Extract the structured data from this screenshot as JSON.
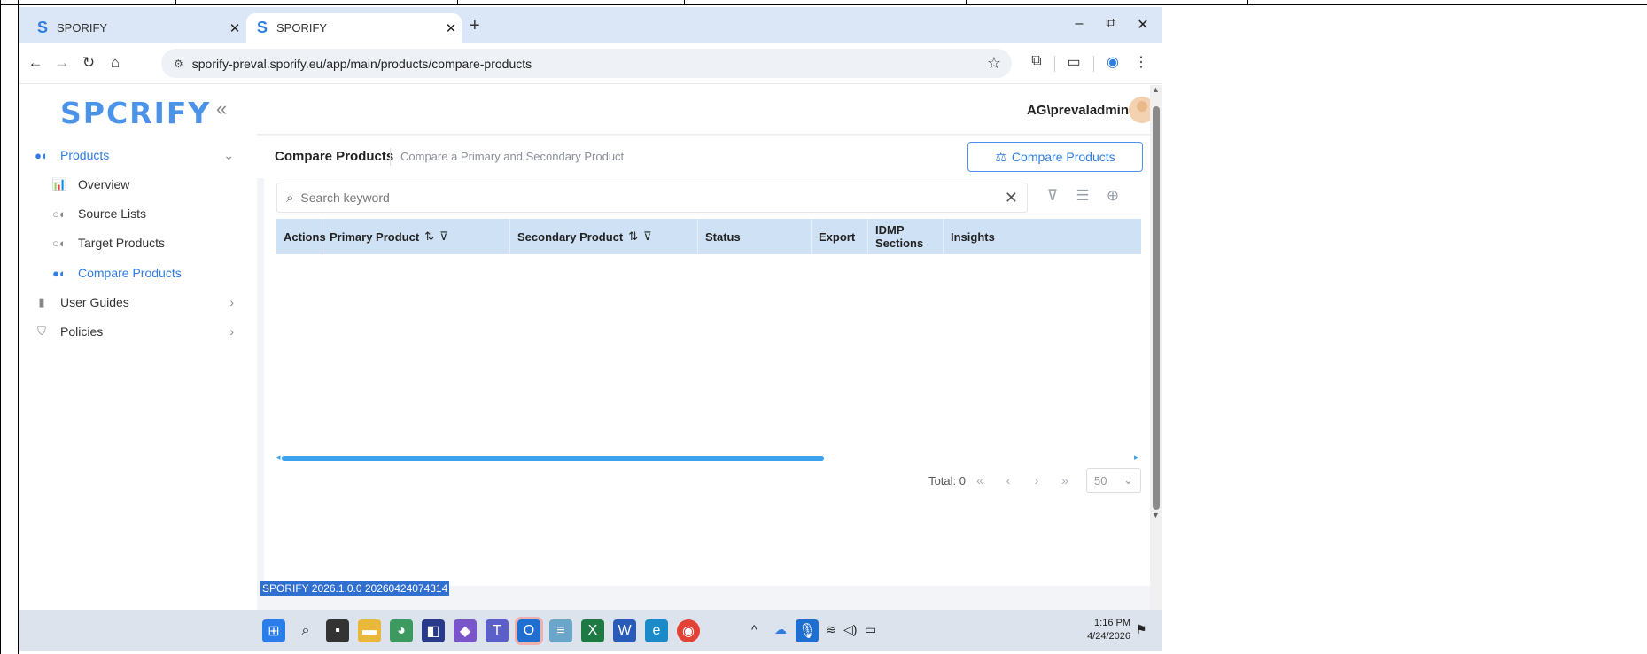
{
  "browser": {
    "tabs": [
      {
        "title": "SPORIFY",
        "logo": "S",
        "active": false
      },
      {
        "title": "SPORIFY",
        "logo": "S",
        "active": true
      }
    ],
    "new_tab": "+",
    "url": "sporify-preval.sporify.eu/app/main/products/compare-products",
    "window_controls": {
      "minimize": "–",
      "restore": "⧉",
      "close": "✕"
    }
  },
  "sidebar": {
    "brand": "SPCRIFY",
    "items": [
      {
        "label": "Products",
        "icon": "pills-icon",
        "level": 0,
        "active": true,
        "chevron": "⌄"
      },
      {
        "label": "Overview",
        "icon": "chart-icon",
        "level": 1
      },
      {
        "label": "Source Lists",
        "icon": "pills-icon",
        "level": 1
      },
      {
        "label": "Target Products",
        "icon": "pills-icon",
        "level": 1
      },
      {
        "label": "Compare Products",
        "icon": "pills-icon",
        "level": 1,
        "active": true
      },
      {
        "label": "User Guides",
        "icon": "book-icon",
        "level": 0,
        "chevron": "›"
      },
      {
        "label": "Policies",
        "icon": "shield-icon",
        "level": 0,
        "chevron": "›"
      }
    ]
  },
  "header": {
    "user": "AG\\prevaladmin"
  },
  "page": {
    "title": "Compare Products",
    "subtitle": "Compare a Primary and Secondary Product",
    "compare_button": "Compare Products"
  },
  "search": {
    "placeholder": "Search keyword"
  },
  "table": {
    "columns": [
      "Actions",
      "Primary Product",
      "Secondary Product",
      "Status",
      "Export",
      "IDMP Sections",
      "Insights"
    ],
    "rows": []
  },
  "pager": {
    "total_label": "Total: 0",
    "page_size": "50"
  },
  "version": "SPORIFY 2026.1.0.0 20260424074314",
  "taskbar": {
    "time": "1:16 PM",
    "date": "4/24/2026"
  }
}
